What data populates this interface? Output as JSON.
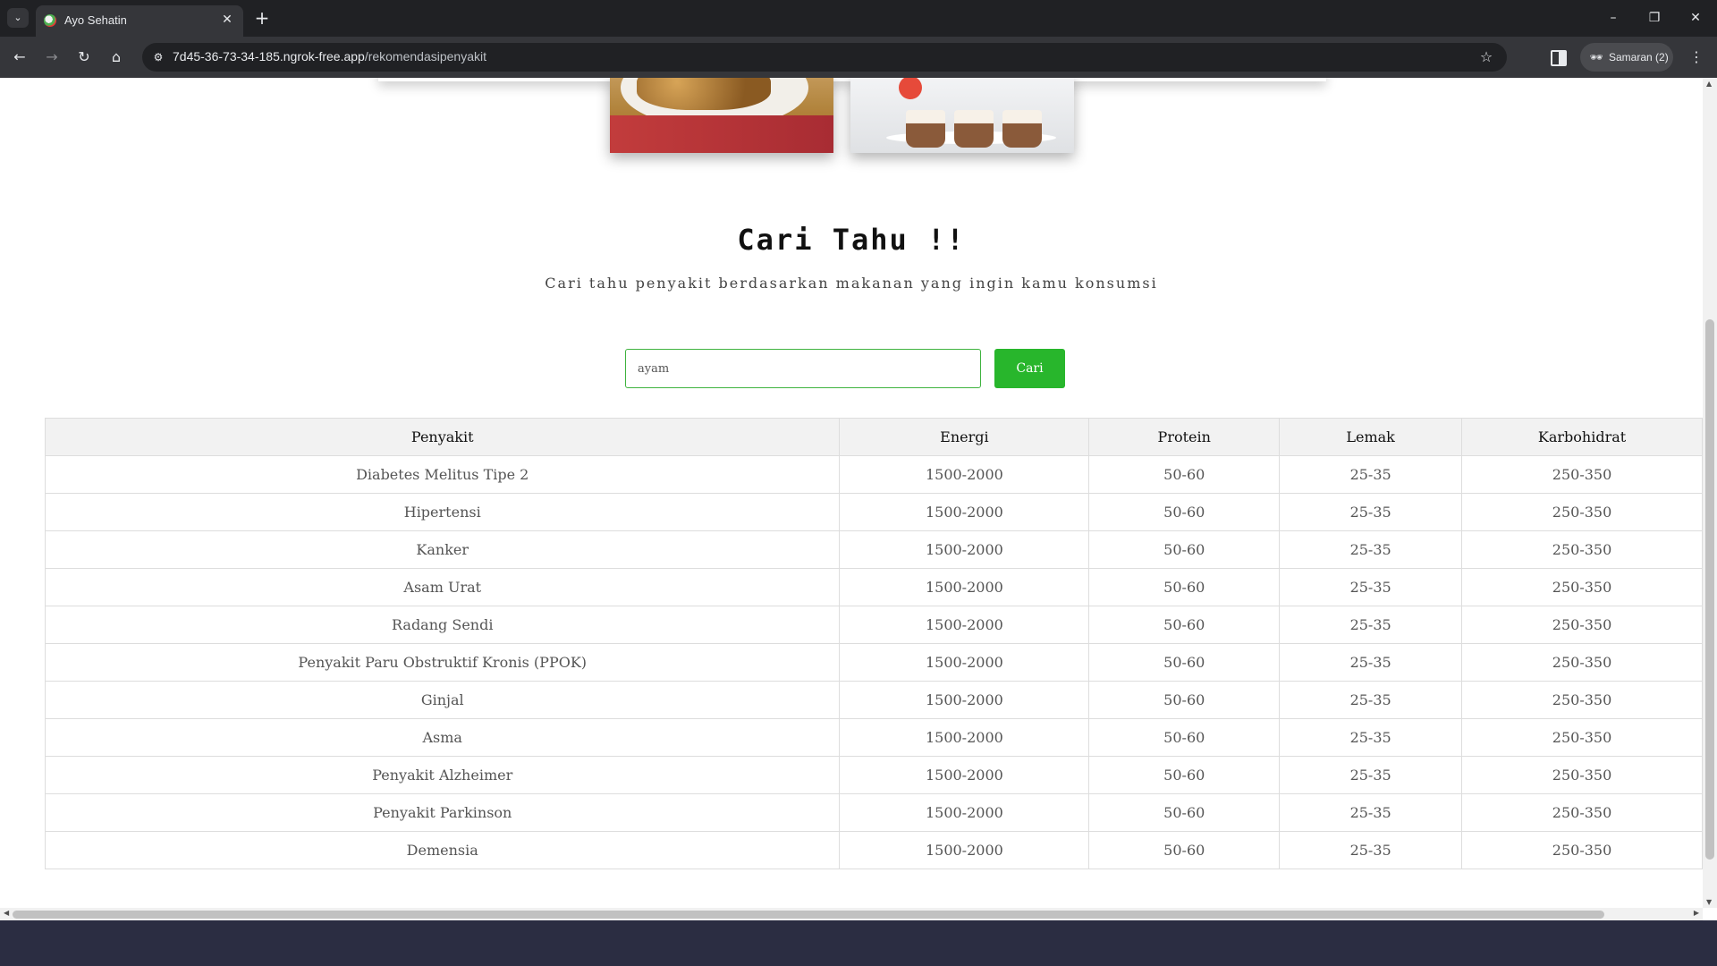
{
  "browser": {
    "tab_title": "Ayo Sehatin",
    "url_host": "7d45-36-73-34-185.ngrok-free.app",
    "url_path": "/rekomendasipenyakit",
    "profile_label": "Samaran (2)"
  },
  "icons": {
    "tab_search": "⌄",
    "close": "✕",
    "new_tab": "+",
    "minimize": "–",
    "restore": "❐",
    "window_close": "✕",
    "back": "←",
    "forward": "→",
    "reload": "↻",
    "home": "⌂",
    "site_info": "⚙",
    "star": "☆",
    "profile": "🕶",
    "menu": "⋮",
    "scroll_up": "▲",
    "scroll_down": "▼",
    "scroll_left": "◀",
    "scroll_right": "▶"
  },
  "section": {
    "title": "Cari Tahu !!",
    "subtitle": "Cari tahu penyakit berdasarkan makanan yang ingin kamu konsumsi"
  },
  "search": {
    "value": "ayam",
    "button_label": "Cari"
  },
  "table": {
    "headers": [
      "Penyakit",
      "Energi",
      "Protein",
      "Lemak",
      "Karbohidrat"
    ],
    "rows": [
      [
        "Diabetes Melitus Tipe 2",
        "1500-2000",
        "50-60",
        "25-35",
        "250-350"
      ],
      [
        "Hipertensi",
        "1500-2000",
        "50-60",
        "25-35",
        "250-350"
      ],
      [
        "Kanker",
        "1500-2000",
        "50-60",
        "25-35",
        "250-350"
      ],
      [
        "Asam Urat",
        "1500-2000",
        "50-60",
        "25-35",
        "250-350"
      ],
      [
        "Radang Sendi",
        "1500-2000",
        "50-60",
        "25-35",
        "250-350"
      ],
      [
        "Penyakit Paru Obstruktif Kronis (PPOK)",
        "1500-2000",
        "50-60",
        "25-35",
        "250-350"
      ],
      [
        "Ginjal",
        "1500-2000",
        "50-60",
        "25-35",
        "250-350"
      ],
      [
        "Asma",
        "1500-2000",
        "50-60",
        "25-35",
        "250-350"
      ],
      [
        "Penyakit Alzheimer",
        "1500-2000",
        "50-60",
        "25-35",
        "250-350"
      ],
      [
        "Penyakit Parkinson",
        "1500-2000",
        "50-60",
        "25-35",
        "250-350"
      ],
      [
        "Demensia",
        "1500-2000",
        "50-60",
        "25-35",
        "250-350"
      ]
    ]
  },
  "colors": {
    "accent_green": "#28b62c",
    "footer": "#2b2d42"
  }
}
